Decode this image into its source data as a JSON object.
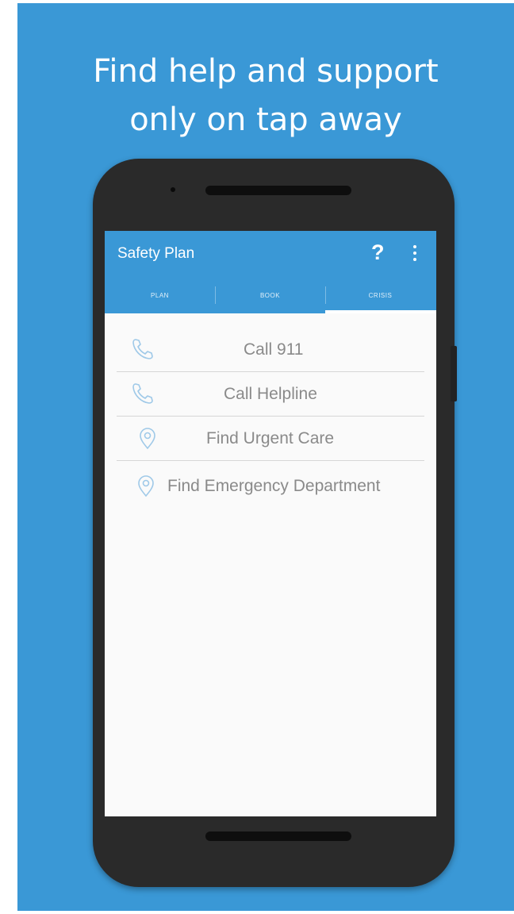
{
  "headline": {
    "line1": "Find help and support",
    "line2": "only on tap away"
  },
  "app": {
    "title": "Safety Plan",
    "help_icon": "help-question-icon",
    "help_label": "?",
    "menu_icon": "more-vert-icon",
    "accent_color": "#3a98d6"
  },
  "tabs": [
    {
      "label": "PLAN",
      "selected": false
    },
    {
      "label": "BOOK",
      "selected": false
    },
    {
      "label": "CRISIS",
      "selected": true
    }
  ],
  "crisis_list": [
    {
      "label": "Call 911",
      "icon": "phone-icon"
    },
    {
      "label": "Call Helpline",
      "icon": "phone-icon"
    },
    {
      "label": "Find Urgent Care",
      "icon": "location-pin-icon"
    },
    {
      "label": "Find Emergency Department",
      "icon": "location-pin-icon"
    }
  ]
}
